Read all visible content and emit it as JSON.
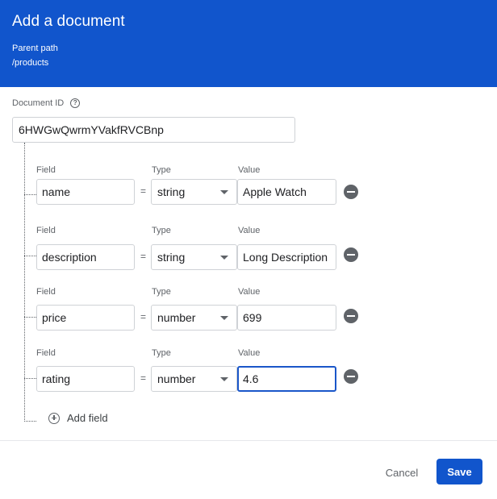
{
  "colors": {
    "brand": "#1155cc",
    "focus": "#1a56c9"
  },
  "header": {
    "title": "Add a document",
    "parent_path_label": "Parent path",
    "parent_path_value": "/products"
  },
  "document_id": {
    "label": "Document ID",
    "value": "6HWGwQwrmYVakfRVCBnp"
  },
  "labels": {
    "field": "Field",
    "type": "Type",
    "value": "Value",
    "equals": "="
  },
  "fields": [
    {
      "name": "name",
      "type": "string",
      "value": "Apple Watch"
    },
    {
      "name": "description",
      "type": "string",
      "value": "Long Description"
    },
    {
      "name": "price",
      "type": "number",
      "value": "699"
    },
    {
      "name": "rating",
      "type": "number",
      "value": "4.6"
    }
  ],
  "add_field_label": "Add field",
  "actions": {
    "cancel_label": "Cancel",
    "save_label": "Save"
  }
}
